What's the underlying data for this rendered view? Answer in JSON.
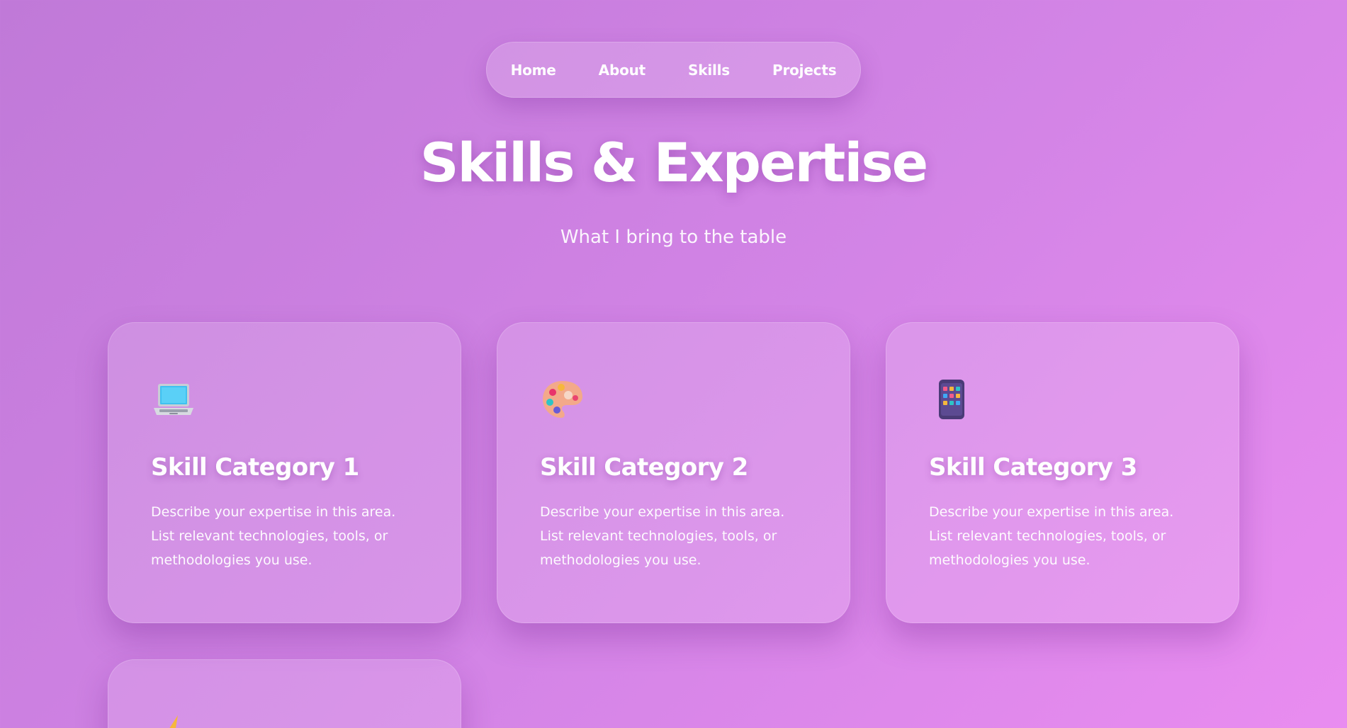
{
  "nav": {
    "items": [
      {
        "label": "Home"
      },
      {
        "label": "About"
      },
      {
        "label": "Skills"
      },
      {
        "label": "Projects"
      }
    ]
  },
  "header": {
    "title": "Skills & Expertise",
    "subtitle": "What I bring to the table"
  },
  "cards": [
    {
      "icon": "laptop-icon",
      "title": "Skill Category 1",
      "description": "Describe your expertise in this area. List relevant technologies, tools, or methodologies you use."
    },
    {
      "icon": "palette-icon",
      "title": "Skill Category 2",
      "description": "Describe your expertise in this area. List relevant technologies, tools, or methodologies you use."
    },
    {
      "icon": "mobile-phone-icon",
      "title": "Skill Category 3",
      "description": "Describe your expertise in this area. List relevant technologies, tools, or methodologies you use."
    },
    {
      "icon": "lightning-icon"
    }
  ],
  "colors": {
    "background_start": "#c079d8",
    "background_end": "#e98cf0",
    "text": "#ffffff"
  }
}
